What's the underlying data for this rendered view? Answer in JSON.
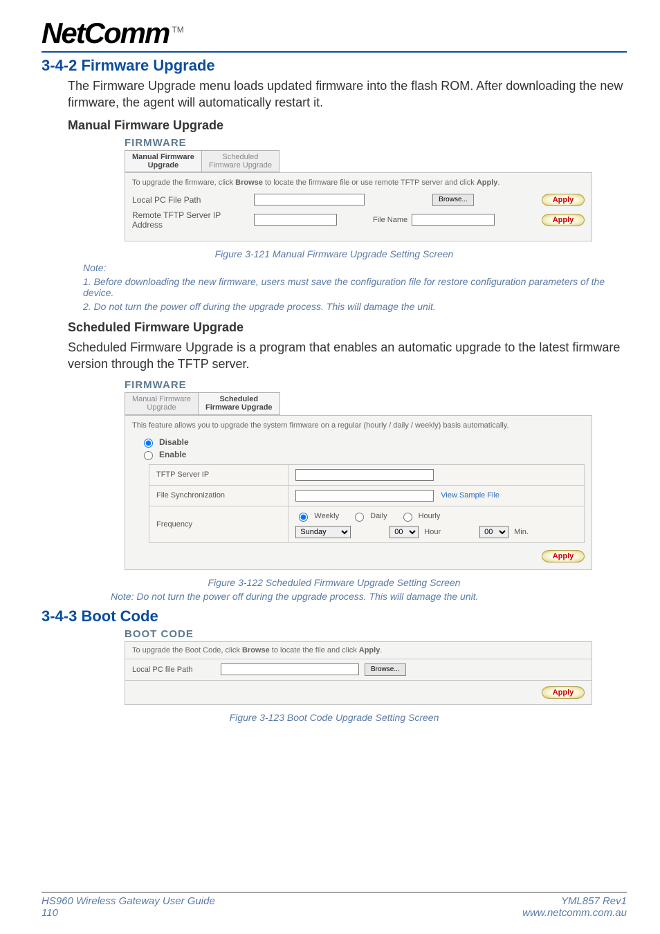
{
  "logo": {
    "text": "NetComm",
    "tm": "TM"
  },
  "section1": {
    "title": "3-4-2 Firmware Upgrade",
    "body": "The Firmware Upgrade menu loads updated firmware into the flash ROM. After downloading the new firmware, the agent will automatically restart it.",
    "subtitle": "Manual Firmware Upgrade"
  },
  "fw1": {
    "header": "FIRMWARE",
    "tab1_l1": "Manual Firmware",
    "tab1_l2": "Upgrade",
    "tab2_l1": "Scheduled",
    "tab2_l2": "Firmware Upgrade",
    "instr_pre": "To upgrade the firmware, click ",
    "instr_b1": "Browse",
    "instr_mid": " to locate the firmware file or use remote TFTP server and click ",
    "instr_b2": "Apply",
    "instr_post": ".",
    "local_label": "Local PC File Path",
    "browse_btn": "Browse...",
    "apply_btn": "Apply",
    "remote_label": "Remote TFTP Server IP Address",
    "filename_label": "File Name"
  },
  "caption1": "Figure 3-121 Manual Firmware Upgrade Setting Screen",
  "notes": {
    "heading": "Note:",
    "n1": "1. Before downloading the new firmware, users must save the configuration file for restore configuration parameters of the device.",
    "n2": "2. Do not turn the power off during the upgrade process. This will damage the unit."
  },
  "section2": {
    "subtitle": "Scheduled Firmware Upgrade",
    "body": "Scheduled Firmware Upgrade is a program that enables an automatic upgrade to the latest firmware version through the TFTP server."
  },
  "fw2": {
    "header": "FIRMWARE",
    "tab1_l1": "Manual Firmware",
    "tab1_l2": "Upgrade",
    "tab2_l1": "Scheduled",
    "tab2_l2": "Firmware Upgrade",
    "instr": "This feature allows you to upgrade the system firmware on a regular (hourly / daily / weekly) basis automatically.",
    "radio_disable": "Disable",
    "radio_enable": "Enable",
    "tftp_label": "TFTP Server IP",
    "filesync_label": "File Synchronization",
    "view_sample": "View Sample File",
    "freq_label": "Frequency",
    "freq_weekly": "Weekly",
    "freq_daily": "Daily",
    "freq_hourly": "Hourly",
    "day_value": "Sunday",
    "hour_value": "00",
    "hour_label": "Hour",
    "min_value": "00",
    "min_label": "Min.",
    "apply_btn": "Apply"
  },
  "caption2": "Figure 3-122 Scheduled Firmware Upgrade Setting Screen",
  "note_single": "Note: Do not turn the power off during the upgrade process. This will damage the unit.",
  "section3": {
    "title": "3-4-3 Boot Code"
  },
  "boot": {
    "header": "BOOT CODE",
    "instr_pre": "To upgrade the Boot Code, click ",
    "instr_b1": "Browse",
    "instr_mid": " to locate the file and click ",
    "instr_b2": "Apply",
    "instr_post": ".",
    "local_label": "Local PC file Path",
    "browse_btn": "Browse...",
    "apply_btn": "Apply"
  },
  "caption3": "Figure 3-123 Boot Code Upgrade Setting Screen",
  "footer": {
    "left1": "HS960 Wireless Gateway User Guide",
    "left2": "110",
    "right1": "YML857 Rev1",
    "right2": "www.netcomm.com.au"
  }
}
